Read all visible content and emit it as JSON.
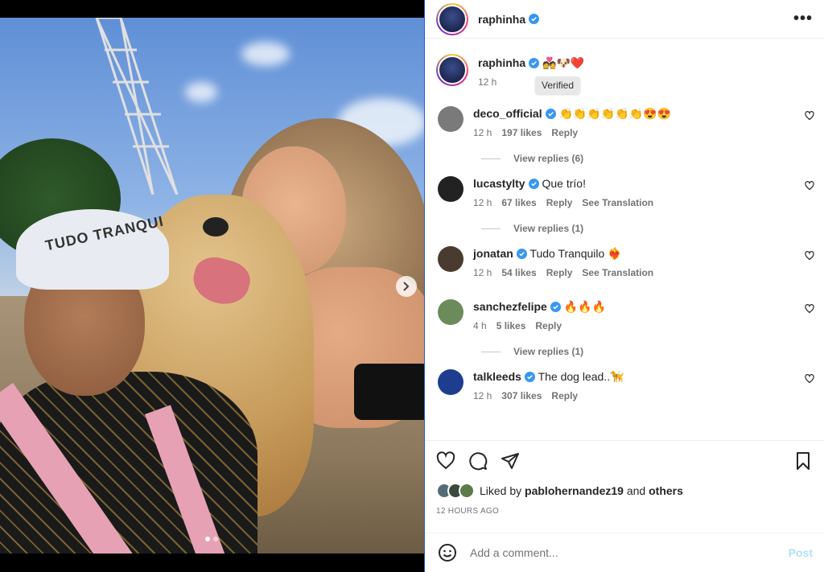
{
  "post": {
    "author": "raphinha",
    "more_glyph": "•••",
    "caption_text": "💑🐶❤️",
    "caption_time": "12 h",
    "tooltip": "Verified",
    "cap_text": "TUDO TRANQUI"
  },
  "comments": [
    {
      "user": "deco_official",
      "text": "👏👏👏👏👏👏😍😍",
      "time": "12 h",
      "likes": "197 likes",
      "reply": "Reply",
      "translate": "",
      "replies": "View replies (6)",
      "avatar": "#7a7a7a"
    },
    {
      "user": "lucastylty",
      "text": "Que trío!",
      "time": "12 h",
      "likes": "67 likes",
      "reply": "Reply",
      "translate": "See Translation",
      "replies": "View replies (1)",
      "avatar": "#222222"
    },
    {
      "user": "jonatan",
      "text": "Tudo Tranquilo ❤️‍🔥",
      "time": "12 h",
      "likes": "54 likes",
      "reply": "Reply",
      "translate": "See Translation",
      "replies": "",
      "avatar": "#4a3a30"
    },
    {
      "user": "sanchezfelipe",
      "text": "🔥🔥🔥",
      "time": "4 h",
      "likes": "5 likes",
      "reply": "Reply",
      "translate": "",
      "replies": "View replies (1)",
      "avatar": "#6b8c5a"
    },
    {
      "user": "talkleeds",
      "text": "The dog lead..🦮",
      "time": "12 h",
      "likes": "307 likes",
      "reply": "Reply",
      "translate": "",
      "replies": "",
      "avatar": "#1d3d8f"
    }
  ],
  "liked": {
    "prefix": "Liked by",
    "user": "pablohernandez19",
    "and": "and",
    "others": "others",
    "time_ago": "12 HOURS AGO"
  },
  "add_comment": {
    "placeholder": "Add a comment...",
    "post_label": "Post"
  },
  "colors": {
    "verified": "#3897f0",
    "link_muted": "#737373",
    "post_disabled": "#b2dffc"
  }
}
